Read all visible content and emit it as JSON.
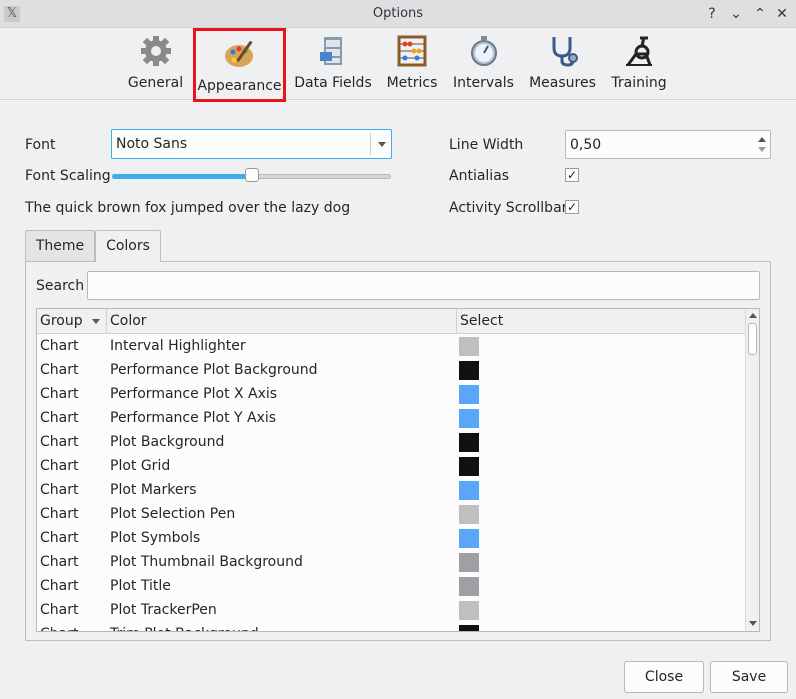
{
  "window": {
    "title": "Options",
    "app_icon": "x-app-icon",
    "controls": [
      "?",
      "⌄",
      "⌃",
      "✕"
    ]
  },
  "toolbar": {
    "items": [
      {
        "label": "General",
        "icon": "gear-icon"
      },
      {
        "label": "Appearance",
        "icon": "palette-icon",
        "selected": true
      },
      {
        "label": "Data Fields",
        "icon": "cabinet-icon"
      },
      {
        "label": "Metrics",
        "icon": "abacus-icon"
      },
      {
        "label": "Intervals",
        "icon": "stopwatch-icon"
      },
      {
        "label": "Measures",
        "icon": "stethoscope-icon"
      },
      {
        "label": "Training",
        "icon": "bike-trainer-icon"
      }
    ]
  },
  "appearance": {
    "font_label": "Font",
    "font_value": "Noto Sans",
    "font_scaling_label": "Font Scaling",
    "font_scaling_level": 0.5,
    "sample_text": "The quick brown fox jumped over the lazy dog",
    "line_width_label": "Line Width",
    "line_width_value": "0,50",
    "antialias_label": "Antialias",
    "antialias_checked": true,
    "activity_scrollbar_label": "Activity Scrollbar",
    "activity_scrollbar_checked": true
  },
  "tabs": [
    {
      "label": "Theme",
      "active": false
    },
    {
      "label": "Colors",
      "active": true
    }
  ],
  "colors_tab": {
    "search_label": "Search",
    "search_value": "",
    "columns": [
      "Group",
      "Color",
      "Select"
    ],
    "rows": [
      {
        "group": "Chart",
        "color": "Interval Highlighter",
        "swatch": "#c0c0c0"
      },
      {
        "group": "Chart",
        "color": "Performance Plot Background",
        "swatch": "#111111"
      },
      {
        "group": "Chart",
        "color": "Performance Plot X Axis",
        "swatch": "#58a7f8"
      },
      {
        "group": "Chart",
        "color": "Performance Plot Y Axis",
        "swatch": "#58a7f8"
      },
      {
        "group": "Chart",
        "color": "Plot Background",
        "swatch": "#111111"
      },
      {
        "group": "Chart",
        "color": "Plot Grid",
        "swatch": "#111111"
      },
      {
        "group": "Chart",
        "color": "Plot Markers",
        "swatch": "#58a7f8"
      },
      {
        "group": "Chart",
        "color": "Plot Selection Pen",
        "swatch": "#c0c0c0"
      },
      {
        "group": "Chart",
        "color": "Plot Symbols",
        "swatch": "#58a7f8"
      },
      {
        "group": "Chart",
        "color": "Plot Thumbnail Background",
        "swatch": "#a0a0a4"
      },
      {
        "group": "Chart",
        "color": "Plot Title",
        "swatch": "#a0a0a4"
      },
      {
        "group": "Chart",
        "color": "Plot TrackerPen",
        "swatch": "#c0c0c0"
      },
      {
        "group": "Chart",
        "color": "Trim Plot Background",
        "swatch": "#111111"
      }
    ]
  },
  "footer": {
    "close_label": "Close",
    "save_label": "Save"
  }
}
